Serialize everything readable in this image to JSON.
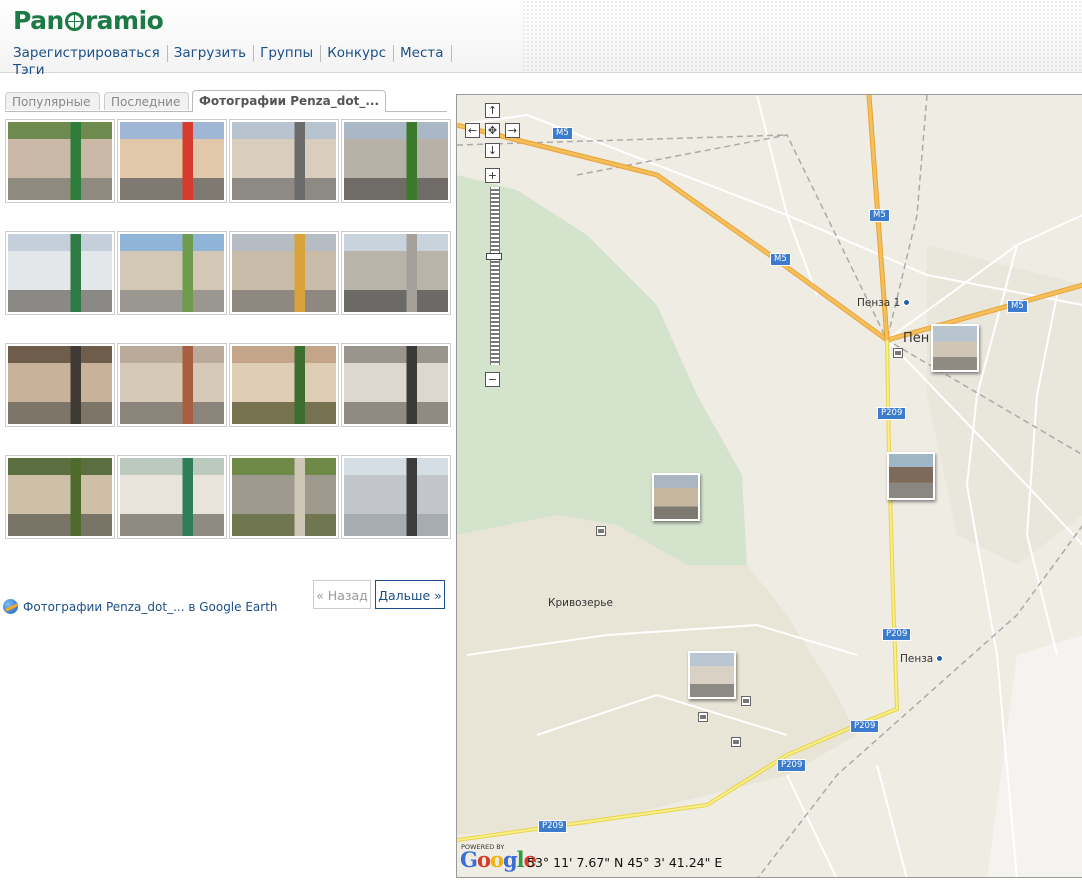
{
  "header": {
    "logo": "Panoramio",
    "nav": [
      "Зарегистрироваться",
      "Загрузить",
      "Группы",
      "Конкурс",
      "Места",
      "Тэги"
    ]
  },
  "tabs": [
    {
      "label": "Популярные",
      "active": false
    },
    {
      "label": "Последние",
      "active": false
    },
    {
      "label": "Фотографии Penza_dot_...",
      "active": true
    }
  ],
  "photos": [
    {
      "sky": "#6e8a4f",
      "wall": "#c9b9a6",
      "ground": "#8f8a7e",
      "accent": "#2e7d3a"
    },
    {
      "sky": "#9fb6d4",
      "wall": "#e1c8a8",
      "ground": "#7e7a72",
      "accent": "#d73b2e"
    },
    {
      "sky": "#b7c3cf",
      "wall": "#d9cdbd",
      "ground": "#8d8a84",
      "accent": "#6b6b6b"
    },
    {
      "sky": "#aab7c4",
      "wall": "#b7b0a6",
      "ground": "#6f6c67",
      "accent": "#3b7a2a"
    },
    {
      "sky": "#c5cfdc",
      "wall": "#e4e7ea",
      "ground": "#8a8986",
      "accent": "#2d7a44"
    },
    {
      "sky": "#8fb4d8",
      "wall": "#d3c8b6",
      "ground": "#9a9690",
      "accent": "#6e9b4c"
    },
    {
      "sky": "#b5bcc4",
      "wall": "#c8bca9",
      "ground": "#8e8881",
      "accent": "#d9a23a"
    },
    {
      "sky": "#c9d3de",
      "wall": "#b9b4aa",
      "ground": "#6c6a66",
      "accent": "#a5a19a"
    },
    {
      "sky": "#6f5d4c",
      "wall": "#c8b29a",
      "ground": "#7e7569",
      "accent": "#3f3a33"
    },
    {
      "sky": "#b9aa9a",
      "wall": "#d7c9b7",
      "ground": "#8c857c",
      "accent": "#a75f3f"
    },
    {
      "sky": "#c4a589",
      "wall": "#e0cdb6",
      "ground": "#77724f",
      "accent": "#3b6e2f"
    },
    {
      "sky": "#9a958c",
      "wall": "#ddd8cf",
      "ground": "#8f8b83",
      "accent": "#3a3a38"
    },
    {
      "sky": "#5b6e3f",
      "wall": "#cdbfa8",
      "ground": "#7a7466",
      "accent": "#4e6b2c"
    },
    {
      "sky": "#bcc9bf",
      "wall": "#e8e4dc",
      "ground": "#8e8b82",
      "accent": "#2f7e57"
    },
    {
      "sky": "#6f8a46",
      "wall": "#9f9a8e",
      "ground": "#6f7650",
      "accent": "#cfc7b5"
    },
    {
      "sky": "#d5dde5",
      "wall": "#c2c6ca",
      "ground": "#a7acb1",
      "accent": "#3c3c3c"
    }
  ],
  "pagination": {
    "prev": "« Назад",
    "next": "Дальше »"
  },
  "google_earth": "Фотографии Penza_dot_... в Google Earth",
  "map": {
    "controls": {
      "up": "↑",
      "left": "←",
      "center": "✥",
      "right": "→",
      "down": "↓",
      "zoom_in": "+",
      "zoom_out": "−"
    },
    "road_labels": [
      "M5",
      "M5",
      "M5",
      "M5",
      "P209",
      "P209",
      "P209",
      "P209",
      "P209"
    ],
    "places": [
      "Пенза 1",
      "Пен",
      "Кривозерье",
      "Пенза"
    ],
    "powered_by": "POWERED BY",
    "google": "Google",
    "coordinates": "53° 11' 7.67\" N 45° 3' 41.24\" E"
  },
  "colors": {
    "accent": "#1a4f8a",
    "logo": "#1c7a46",
    "road_major": "#f2b23c",
    "road_minor": "#f5e35a",
    "map_bg": "#efece4",
    "park": "#d4e3cc"
  }
}
